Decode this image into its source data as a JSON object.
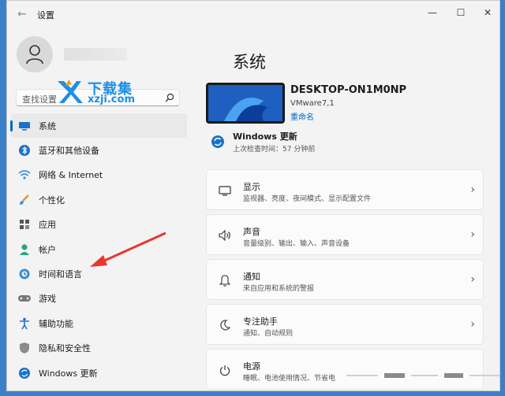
{
  "window": {
    "back": "←",
    "title": "设置",
    "min": "—",
    "max": "☐",
    "close": "✕"
  },
  "profile": {
    "name": ""
  },
  "search": {
    "placeholder": "查找设置"
  },
  "watermark": {
    "cn": "下载集",
    "en": "xzji.com"
  },
  "nav": [
    {
      "label": "系统",
      "icon": "monitor-icon",
      "active": true
    },
    {
      "label": "蓝牙和其他设备",
      "icon": "bluetooth-icon"
    },
    {
      "label": "网络 & Internet",
      "icon": "wifi-icon"
    },
    {
      "label": "个性化",
      "icon": "brush-icon"
    },
    {
      "label": "应用",
      "icon": "apps-icon"
    },
    {
      "label": "帐户",
      "icon": "account-icon"
    },
    {
      "label": "时间和语言",
      "icon": "globe-clock-icon"
    },
    {
      "label": "游戏",
      "icon": "gamepad-icon"
    },
    {
      "label": "辅助功能",
      "icon": "accessibility-icon"
    },
    {
      "label": "隐私和安全性",
      "icon": "shield-icon"
    },
    {
      "label": "Windows 更新",
      "icon": "update-icon"
    }
  ],
  "main": {
    "title": "系统",
    "device": {
      "name": "DESKTOP-ON1M0NP",
      "model": "VMware7,1",
      "rename": "重命名"
    },
    "update": {
      "title": "Windows 更新",
      "subtitle": "上次检查时间：57 分钟前"
    },
    "cards": [
      {
        "title": "显示",
        "subtitle": "监视器、亮度、夜间模式、显示配置文件",
        "icon": "display-icon"
      },
      {
        "title": "声音",
        "subtitle": "音量级别、输出、输入、声音设备",
        "icon": "speaker-icon"
      },
      {
        "title": "通知",
        "subtitle": "来自应用和系统的警报",
        "icon": "bell-icon"
      },
      {
        "title": "专注助手",
        "subtitle": "通知、自动规则",
        "icon": "moon-icon"
      },
      {
        "title": "电源",
        "subtitle": "睡眠、电池使用情况、节省电",
        "icon": "power-icon"
      }
    ],
    "chevron": "›"
  },
  "colors": {
    "accent": "#0067c0",
    "annotation_arrow": "#e8372d",
    "desktop": "#3b7fc9"
  }
}
